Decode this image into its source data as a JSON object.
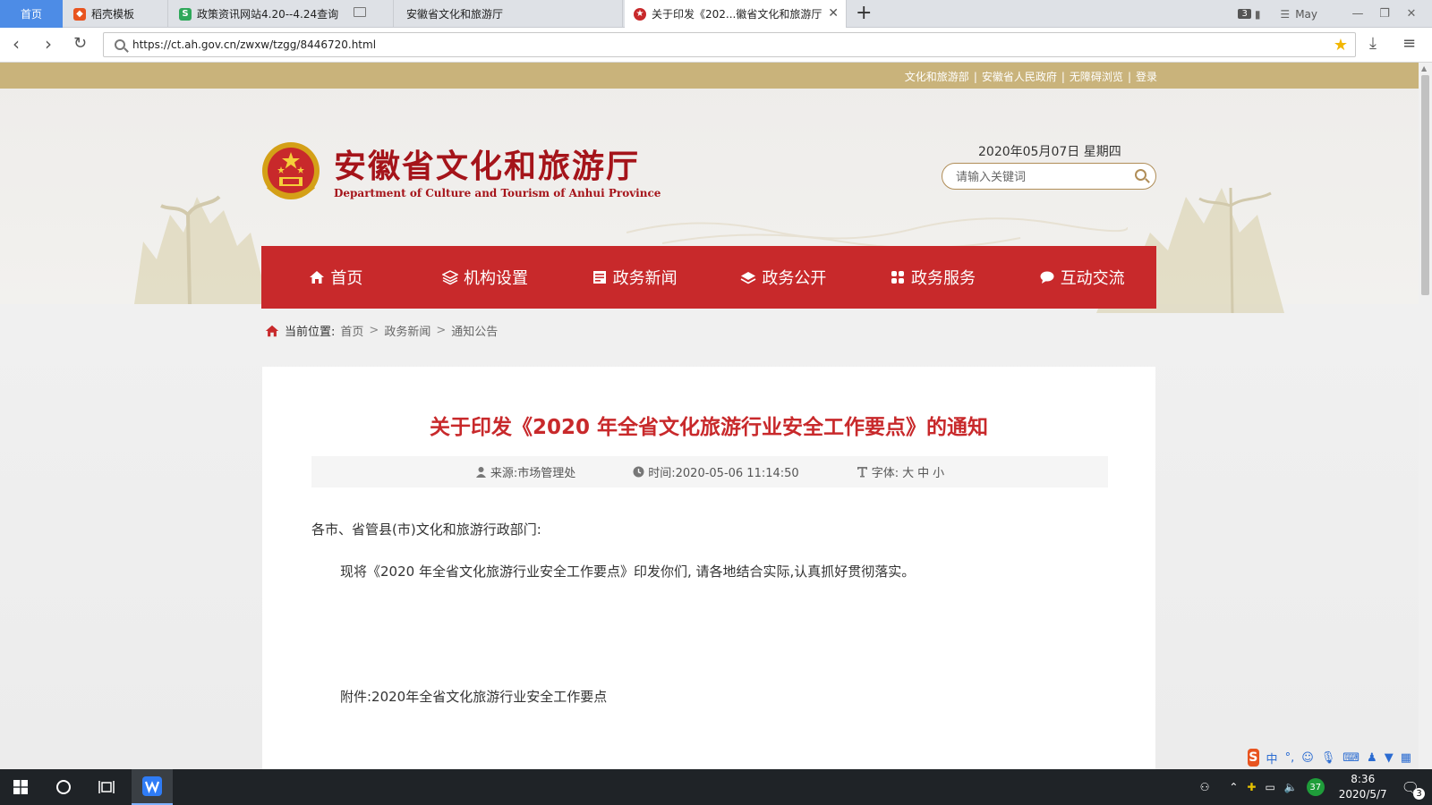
{
  "browser": {
    "tabs": [
      {
        "label": "首页",
        "kind": "home",
        "favicon_color": "#4d8ce6"
      },
      {
        "label": "稻壳模板",
        "favicon_color": "#e8541f"
      },
      {
        "label": "政策资讯网站4.20--4.24查询",
        "favicon_color": "#2fa85a"
      },
      {
        "label": "安徽省文化和旅游厅",
        "favicon_color": ""
      },
      {
        "label": "关于印发《202...徽省文化和旅游厅",
        "favicon_color": "#c8292b",
        "active": true
      }
    ],
    "tab_count": "3",
    "menu_label": "May",
    "url": "https://ct.ah.gov.cn/zwxw/tzgg/8446720.html"
  },
  "site": {
    "top_links": [
      "文化和旅游部",
      "安徽省人民政府",
      "无障碍浏览",
      "登录"
    ],
    "title": "安徽省文化和旅游厅",
    "subtitle": "Department of Culture and Tourism of Anhui Province",
    "date": "2020年05月07日 星期四",
    "search_placeholder": "请输入关键词",
    "nav": [
      {
        "label": "首页",
        "icon": "home-icon"
      },
      {
        "label": "机构设置",
        "icon": "layers-icon"
      },
      {
        "label": "政务新闻",
        "icon": "news-icon"
      },
      {
        "label": "政务公开",
        "icon": "stack-icon"
      },
      {
        "label": "政务服务",
        "icon": "grid-icon"
      },
      {
        "label": "互动交流",
        "icon": "chat-icon"
      }
    ],
    "colors": {
      "brand_red": "#c8292b",
      "gold": "#c9b37b",
      "title_red": "#a5141a"
    }
  },
  "breadcrumb": {
    "label": "当前位置:",
    "items": [
      "首页",
      "政务新闻",
      "通知公告"
    ]
  },
  "article": {
    "title": "关于印发《2020 年全省文化旅游行业安全工作要点》的通知",
    "source": "来源:市场管理处",
    "time": "时间:2020-05-06 11:14:50",
    "font_label": "字体:",
    "font_sizes": [
      "大",
      "中",
      "小"
    ],
    "salutation": "各市、省管县(市)文化和旅游行政部门:",
    "body": "现将《2020 年全省文化旅游行业安全工作要点》印发你们, 请各地结合实际,认真抓好贯彻落实。",
    "attachment": "附件:2020年全省文化旅游行业安全工作要点"
  },
  "ime": {
    "mode": "中"
  },
  "taskbar": {
    "tray_badge": "37",
    "time": "8:36",
    "date": "2020/5/7",
    "notifications": "3"
  }
}
